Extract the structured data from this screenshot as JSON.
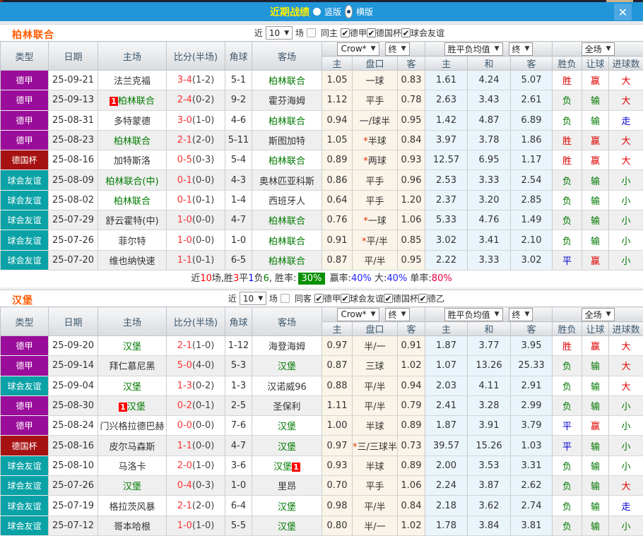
{
  "titlebar": {
    "title": "近期战绩",
    "view_options": [
      {
        "label": "竖版",
        "selected": false
      },
      {
        "label": "横版",
        "selected": true
      }
    ],
    "close_icon": "✕"
  },
  "colors": {
    "league": {
      "德甲": "#9a0d9a",
      "德国杯": "#a61212",
      "球会友谊": "#0aa2a6"
    },
    "result": {
      "胜": "#dd0000",
      "负": "#007700",
      "平": "#0000cc",
      "赢": "#dd0000",
      "输": "#007700",
      "大": "#dd0000",
      "小": "#007700",
      "走": "#0000cc"
    },
    "team_green": "#007a00",
    "score_red": "#ff3333",
    "mark_red": "#ff0000"
  },
  "columns": [
    "类型",
    "日期",
    "主场",
    "比分(半场)",
    "角球",
    "客场",
    "主",
    "盘口",
    "客",
    "主",
    "和",
    "客",
    "胜负",
    "让球",
    "进球数"
  ],
  "sections": [
    {
      "team": "柏林联合",
      "filter": {
        "near_label": "近",
        "count": "10",
        "unit_label": "场",
        "checks": [
          {
            "label": "同主",
            "checked": false
          },
          {
            "label": "德甲",
            "checked": true
          },
          {
            "label": "德国杯",
            "checked": true
          },
          {
            "label": "球会友谊",
            "checked": true
          }
        ]
      },
      "dropdowns": {
        "odds_src": "Crow*",
        "odds_time": "终",
        "avg": "胜平负均值",
        "avg_time": "终",
        "scope": "全场"
      },
      "rows": [
        {
          "league": "德甲",
          "date": "25-09-21",
          "home": "法兰克福",
          "home_green": false,
          "home_mark": "",
          "score": "3-4",
          "half": "(1-2)",
          "corners": "5-1",
          "away": "柏林联合",
          "away_green": true,
          "away_mark": "",
          "let_home": "1.05",
          "handicap": "一球",
          "handicap_star": false,
          "let_away": "0.83",
          "avg_home": "1.61",
          "avg_draw": "4.24",
          "avg_away": "5.07",
          "result": "胜",
          "spread": "赢",
          "goals": "大"
        },
        {
          "league": "德甲",
          "date": "25-09-13",
          "home": "柏林联合",
          "home_green": true,
          "home_mark": "1",
          "score": "2-4",
          "half": "(0-2)",
          "corners": "9-2",
          "away": "霍芬海姆",
          "away_green": false,
          "away_mark": "",
          "let_home": "1.12",
          "handicap": "平手",
          "handicap_star": false,
          "let_away": "0.78",
          "avg_home": "2.63",
          "avg_draw": "3.43",
          "avg_away": "2.61",
          "result": "负",
          "spread": "输",
          "goals": "大"
        },
        {
          "league": "德甲",
          "date": "25-08-31",
          "home": "多特蒙德",
          "home_green": false,
          "home_mark": "",
          "score": "3-0",
          "half": "(1-0)",
          "corners": "4-6",
          "away": "柏林联合",
          "away_green": true,
          "away_mark": "",
          "let_home": "0.94",
          "handicap": "一/球半",
          "handicap_star": false,
          "let_away": "0.95",
          "avg_home": "1.42",
          "avg_draw": "4.87",
          "avg_away": "6.89",
          "result": "负",
          "spread": "输",
          "goals": "走"
        },
        {
          "league": "德甲",
          "date": "25-08-23",
          "home": "柏林联合",
          "home_green": true,
          "home_mark": "",
          "score": "2-1",
          "half": "(2-0)",
          "corners": "5-11",
          "away": "斯图加特",
          "away_green": false,
          "away_mark": "",
          "let_home": "1.05",
          "handicap": "半球",
          "handicap_star": true,
          "let_away": "0.84",
          "avg_home": "3.97",
          "avg_draw": "3.78",
          "avg_away": "1.86",
          "result": "胜",
          "spread": "赢",
          "goals": "大"
        },
        {
          "league": "德国杯",
          "date": "25-08-16",
          "home": "加特斯洛",
          "home_green": false,
          "home_mark": "",
          "score": "0-5",
          "half": "(0-3)",
          "corners": "5-4",
          "away": "柏林联合",
          "away_green": true,
          "away_mark": "",
          "let_home": "0.89",
          "handicap": "两球",
          "handicap_star": true,
          "let_away": "0.93",
          "avg_home": "12.57",
          "avg_draw": "6.95",
          "avg_away": "1.17",
          "result": "胜",
          "spread": "赢",
          "goals": "大"
        },
        {
          "league": "球会友谊",
          "date": "25-08-09",
          "home": "柏林联合(中)",
          "home_green": true,
          "home_mark": "",
          "score": "0-1",
          "half": "(0-0)",
          "corners": "4-3",
          "away": "奥林匹亚科斯",
          "away_green": false,
          "away_mark": "",
          "let_home": "0.86",
          "handicap": "平手",
          "handicap_star": false,
          "let_away": "0.96",
          "avg_home": "2.53",
          "avg_draw": "3.33",
          "avg_away": "2.54",
          "result": "负",
          "spread": "输",
          "goals": "小"
        },
        {
          "league": "球会友谊",
          "date": "25-08-02",
          "home": "柏林联合",
          "home_green": true,
          "home_mark": "",
          "score": "0-1",
          "half": "(0-1)",
          "corners": "1-4",
          "away": "西班牙人",
          "away_green": false,
          "away_mark": "",
          "let_home": "0.64",
          "handicap": "平手",
          "handicap_star": false,
          "let_away": "1.20",
          "avg_home": "2.37",
          "avg_draw": "3.20",
          "avg_away": "2.85",
          "result": "负",
          "spread": "输",
          "goals": "小"
        },
        {
          "league": "球会友谊",
          "date": "25-07-29",
          "home": "舒云霍特(中)",
          "home_green": false,
          "home_mark": "",
          "score": "1-0",
          "half": "(0-0)",
          "corners": "4-7",
          "away": "柏林联合",
          "away_green": true,
          "away_mark": "",
          "let_home": "0.76",
          "handicap": "一球",
          "handicap_star": true,
          "let_away": "1.06",
          "avg_home": "5.33",
          "avg_draw": "4.76",
          "avg_away": "1.49",
          "result": "负",
          "spread": "输",
          "goals": "小"
        },
        {
          "league": "球会友谊",
          "date": "25-07-26",
          "home": "菲尔特",
          "home_green": false,
          "home_mark": "",
          "score": "1-0",
          "half": "(0-0)",
          "corners": "1-0",
          "away": "柏林联合",
          "away_green": true,
          "away_mark": "",
          "let_home": "0.91",
          "handicap": "平/半",
          "handicap_star": true,
          "let_away": "0.85",
          "avg_home": "3.02",
          "avg_draw": "3.41",
          "avg_away": "2.10",
          "result": "负",
          "spread": "输",
          "goals": "小"
        },
        {
          "league": "球会友谊",
          "date": "25-07-20",
          "home": "维也纳快速",
          "home_green": false,
          "home_mark": "",
          "score": "1-1",
          "half": "(0-1)",
          "corners": "6-5",
          "away": "柏林联合",
          "away_green": true,
          "away_mark": "",
          "let_home": "0.87",
          "handicap": "平/半",
          "handicap_star": false,
          "let_away": "0.95",
          "avg_home": "2.22",
          "avg_draw": "3.33",
          "avg_away": "3.02",
          "result": "平",
          "spread": "赢",
          "goals": "小"
        }
      ],
      "summary": [
        {
          "text": "近",
          "color": "#333333"
        },
        {
          "text": "10",
          "color": "#ff0000"
        },
        {
          "text": "场,胜",
          "color": "#333333"
        },
        {
          "text": "3",
          "color": "#ff0000"
        },
        {
          "text": "平",
          "color": "#333333"
        },
        {
          "text": "1",
          "color": "#0000ff"
        },
        {
          "text": "负",
          "color": "#333333"
        },
        {
          "text": "6",
          "color": "#008000"
        },
        {
          "text": ", 胜率:",
          "color": "#333333"
        },
        {
          "text": "30%",
          "color": "#ffffff",
          "bg": "#089000"
        },
        {
          "text": " 赢率:",
          "color": "#333333"
        },
        {
          "text": "40%",
          "color": "#2222ff"
        },
        {
          "text": " 大:",
          "color": "#333333"
        },
        {
          "text": "40%",
          "color": "#2222ff"
        },
        {
          "text": " 单率:",
          "color": "#333333"
        },
        {
          "text": "80%",
          "color": "#e8003f"
        }
      ]
    },
    {
      "team": "汉堡",
      "filter": {
        "near_label": "近",
        "count": "10",
        "unit_label": "场",
        "checks": [
          {
            "label": "同客",
            "checked": false
          },
          {
            "label": "德甲",
            "checked": true
          },
          {
            "label": "球会友谊",
            "checked": true
          },
          {
            "label": "德国杯",
            "checked": true
          },
          {
            "label": "德乙",
            "checked": true
          }
        ]
      },
      "dropdowns": {
        "odds_src": "Crow*",
        "odds_time": "终",
        "avg": "胜平负均值",
        "avg_time": "终",
        "scope": "全场"
      },
      "rows": [
        {
          "league": "德甲",
          "date": "25-09-20",
          "home": "汉堡",
          "home_green": true,
          "home_mark": "",
          "score": "2-1",
          "half": "(1-0)",
          "corners": "1-12",
          "away": "海登海姆",
          "away_green": false,
          "away_mark": "",
          "let_home": "0.97",
          "handicap": "半/一",
          "handicap_star": false,
          "let_away": "0.91",
          "avg_home": "1.87",
          "avg_draw": "3.77",
          "avg_away": "3.95",
          "result": "胜",
          "spread": "赢",
          "goals": "大"
        },
        {
          "league": "德甲",
          "date": "25-09-14",
          "home": "拜仁慕尼黑",
          "home_green": false,
          "home_mark": "",
          "score": "5-0",
          "half": "(4-0)",
          "corners": "5-3",
          "away": "汉堡",
          "away_green": true,
          "away_mark": "",
          "let_home": "0.87",
          "handicap": "三球",
          "handicap_star": false,
          "let_away": "1.02",
          "avg_home": "1.07",
          "avg_draw": "13.26",
          "avg_away": "25.33",
          "result": "负",
          "spread": "输",
          "goals": "大"
        },
        {
          "league": "球会友谊",
          "date": "25-09-04",
          "home": "汉堡",
          "home_green": true,
          "home_mark": "",
          "score": "1-3",
          "half": "(0-2)",
          "corners": "1-3",
          "away": "汉诺威96",
          "away_green": false,
          "away_mark": "",
          "let_home": "0.88",
          "handicap": "平/半",
          "handicap_star": false,
          "let_away": "0.94",
          "avg_home": "2.03",
          "avg_draw": "4.11",
          "avg_away": "2.91",
          "result": "负",
          "spread": "输",
          "goals": "大"
        },
        {
          "league": "德甲",
          "date": "25-08-30",
          "home": "汉堡",
          "home_green": true,
          "home_mark": "1",
          "score": "0-2",
          "half": "(0-1)",
          "corners": "2-5",
          "away": "圣保利",
          "away_green": false,
          "away_mark": "",
          "let_home": "1.11",
          "handicap": "平/半",
          "handicap_star": false,
          "let_away": "0.79",
          "avg_home": "2.41",
          "avg_draw": "3.28",
          "avg_away": "2.99",
          "result": "负",
          "spread": "输",
          "goals": "小"
        },
        {
          "league": "德甲",
          "date": "25-08-24",
          "home": "门兴格拉德巴赫",
          "home_green": false,
          "home_mark": "",
          "score": "0-0",
          "half": "(0-0)",
          "corners": "7-6",
          "away": "汉堡",
          "away_green": true,
          "away_mark": "",
          "let_home": "1.00",
          "handicap": "半球",
          "handicap_star": false,
          "let_away": "0.89",
          "avg_home": "1.87",
          "avg_draw": "3.91",
          "avg_away": "3.79",
          "result": "平",
          "spread": "赢",
          "goals": "小"
        },
        {
          "league": "德国杯",
          "date": "25-08-16",
          "home": "皮尔马森斯",
          "home_green": false,
          "home_mark": "",
          "score": "1-1",
          "half": "(0-0)",
          "corners": "4-7",
          "away": "汉堡",
          "away_green": true,
          "away_mark": "",
          "let_home": "0.97",
          "handicap": "三/三球半",
          "handicap_star": true,
          "let_away": "0.73",
          "avg_home": "39.57",
          "avg_draw": "15.26",
          "avg_away": "1.03",
          "result": "平",
          "spread": "输",
          "goals": "小"
        },
        {
          "league": "球会友谊",
          "date": "25-08-10",
          "home": "马洛卡",
          "home_green": false,
          "home_mark": "",
          "score": "2-0",
          "half": "(1-0)",
          "corners": "3-6",
          "away": "汉堡",
          "away_green": true,
          "away_mark": "1",
          "let_home": "0.93",
          "handicap": "半球",
          "handicap_star": false,
          "let_away": "0.89",
          "avg_home": "2.00",
          "avg_draw": "3.53",
          "avg_away": "3.31",
          "result": "负",
          "spread": "输",
          "goals": "小"
        },
        {
          "league": "球会友谊",
          "date": "25-07-26",
          "home": "汉堡",
          "home_green": true,
          "home_mark": "",
          "score": "0-4",
          "half": "(0-3)",
          "corners": "1-0",
          "away": "里昂",
          "away_green": false,
          "away_mark": "",
          "let_home": "0.70",
          "handicap": "平手",
          "handicap_star": false,
          "let_away": "1.06",
          "avg_home": "2.24",
          "avg_draw": "3.87",
          "avg_away": "2.62",
          "result": "负",
          "spread": "输",
          "goals": "大"
        },
        {
          "league": "球会友谊",
          "date": "25-07-19",
          "home": "格拉茨风暴",
          "home_green": false,
          "home_mark": "",
          "score": "2-1",
          "half": "(2-0)",
          "corners": "6-4",
          "away": "汉堡",
          "away_green": true,
          "away_mark": "",
          "let_home": "0.98",
          "handicap": "平/半",
          "handicap_star": false,
          "let_away": "0.84",
          "avg_home": "2.18",
          "avg_draw": "3.62",
          "avg_away": "2.74",
          "result": "负",
          "spread": "输",
          "goals": "走"
        },
        {
          "league": "球会友谊",
          "date": "25-07-12",
          "home": "哥本哈根",
          "home_green": false,
          "home_mark": "",
          "score": "1-0",
          "half": "(1-0)",
          "corners": "5-5",
          "away": "汉堡",
          "away_green": true,
          "away_mark": "",
          "let_home": "0.80",
          "handicap": "半/一",
          "handicap_star": false,
          "let_away": "1.02",
          "avg_home": "1.78",
          "avg_draw": "3.84",
          "avg_away": "3.81",
          "result": "负",
          "spread": "输",
          "goals": "小"
        }
      ],
      "summary": []
    }
  ]
}
